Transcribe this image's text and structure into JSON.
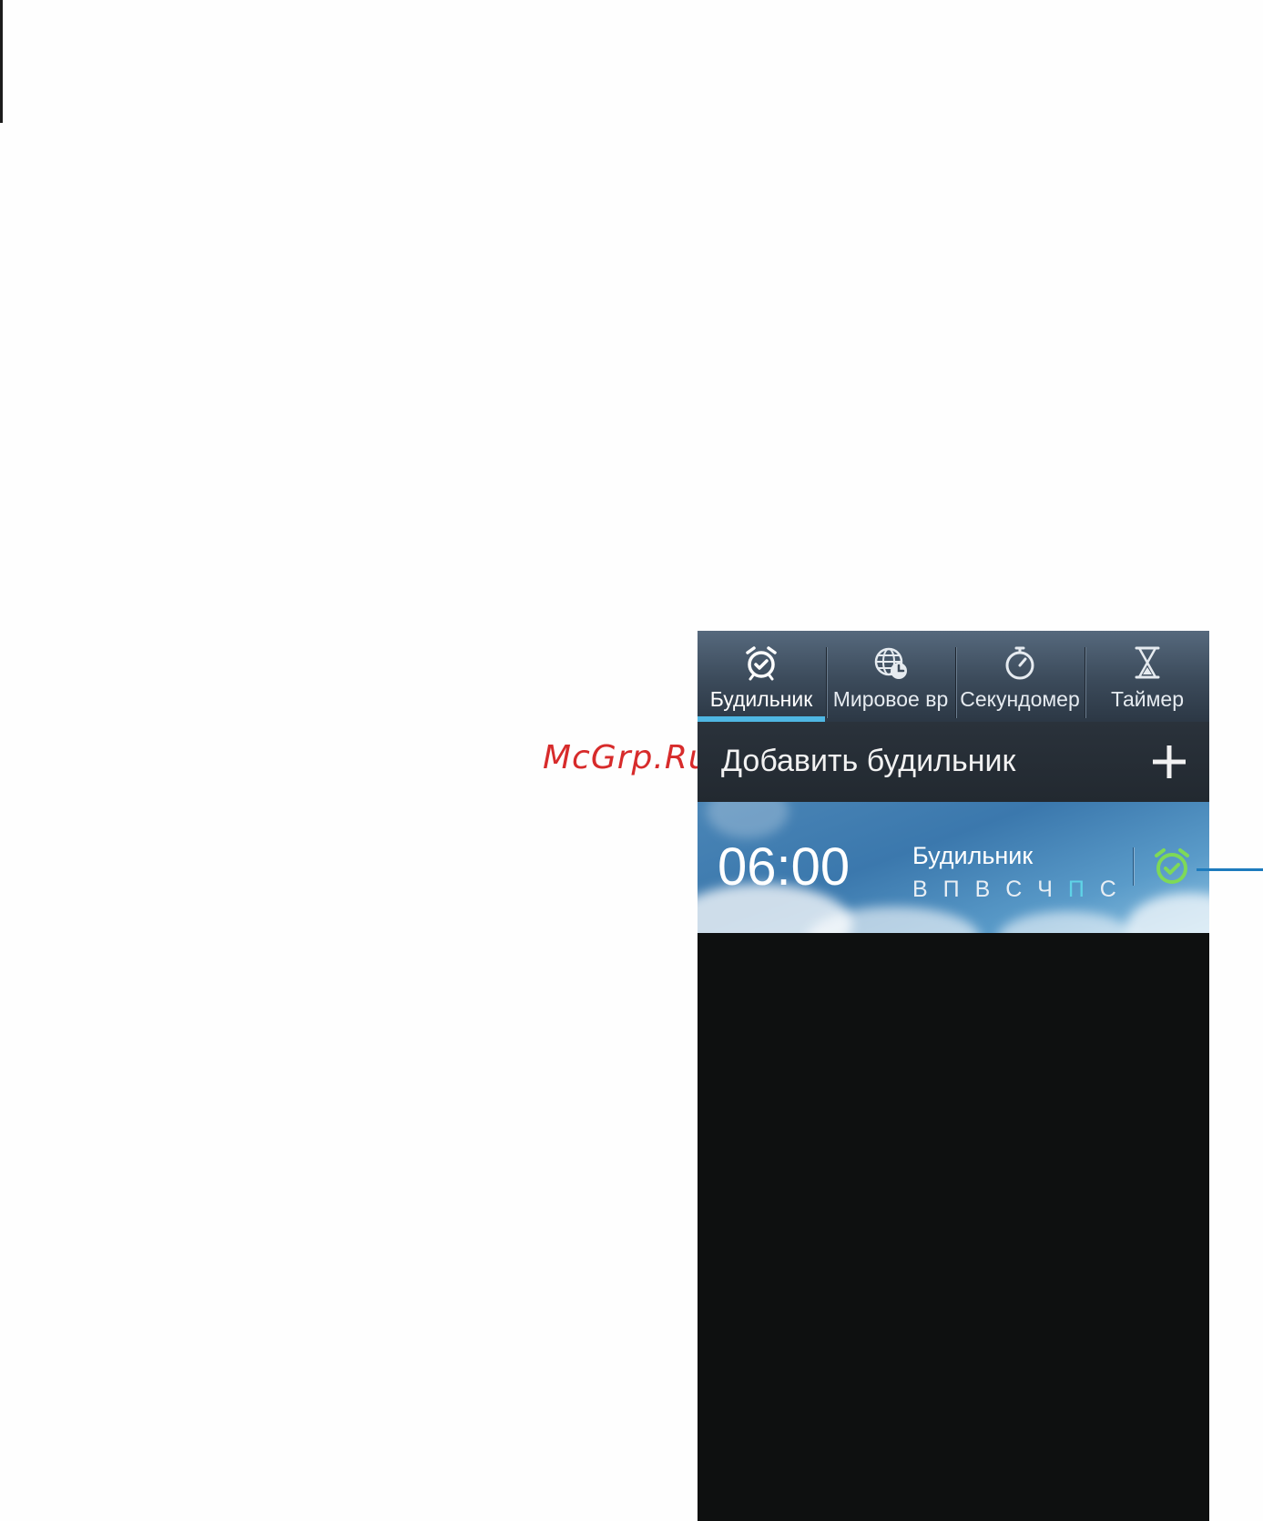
{
  "watermark": "McGrp.Ru",
  "tabs": [
    {
      "label": "Будильник",
      "icon": "alarm-clock-icon",
      "active": true
    },
    {
      "label": "Мировое вр",
      "icon": "world-clock-icon",
      "active": false
    },
    {
      "label": "Секундомер",
      "icon": "stopwatch-icon",
      "active": false
    },
    {
      "label": "Таймер",
      "icon": "hourglass-icon",
      "active": false
    }
  ],
  "add_alarm": {
    "label": "Добавить будильник",
    "icon": "plus-icon"
  },
  "alarm": {
    "time": "06:00",
    "name": "Будильник",
    "days": [
      "В",
      "П",
      "В",
      "С",
      "Ч",
      "П",
      "С"
    ],
    "highlighted_day_index": 5,
    "toggle_icon": "alarm-on-icon",
    "toggle_color": "#7ed957"
  },
  "colors": {
    "tab_indicator": "#4fb7e3",
    "background": "#0e1010",
    "callout": "#1d7bbd",
    "watermark": "#d72b2b"
  }
}
